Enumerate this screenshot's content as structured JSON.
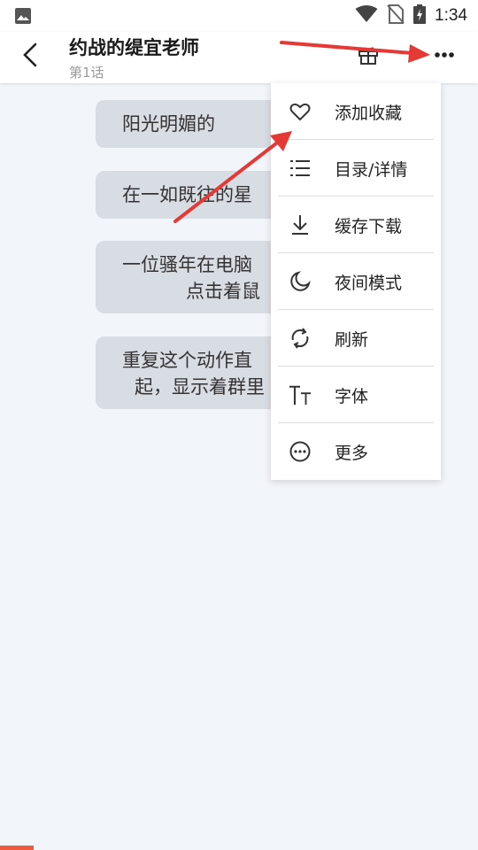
{
  "status_bar": {
    "time": "1:34"
  },
  "app_bar": {
    "title": "约战的缇宜老师",
    "subtitle": "第1话"
  },
  "bubbles": [
    {
      "lines": [
        "阳光明媚的"
      ]
    },
    {
      "lines": [
        "在一如既往的星"
      ]
    },
    {
      "lines": [
        "一位骚年在电脑",
        "点击着鼠"
      ]
    },
    {
      "lines": [
        "重复这个动作直",
        "起，显示着群里"
      ]
    }
  ],
  "menu": {
    "items": [
      {
        "label": "添加收藏",
        "icon": "heart-icon"
      },
      {
        "label": "目录/详情",
        "icon": "list-icon"
      },
      {
        "label": "缓存下载",
        "icon": "download-icon"
      },
      {
        "label": "夜间模式",
        "icon": "moon-icon"
      },
      {
        "label": "刷新",
        "icon": "refresh-icon"
      },
      {
        "label": "字体",
        "icon": "font-icon"
      },
      {
        "label": "更多",
        "icon": "more-circle-icon"
      }
    ]
  },
  "colors": {
    "arrow": "#e53935",
    "bubble": "#d8dce3",
    "background": "#f2f5fa"
  }
}
